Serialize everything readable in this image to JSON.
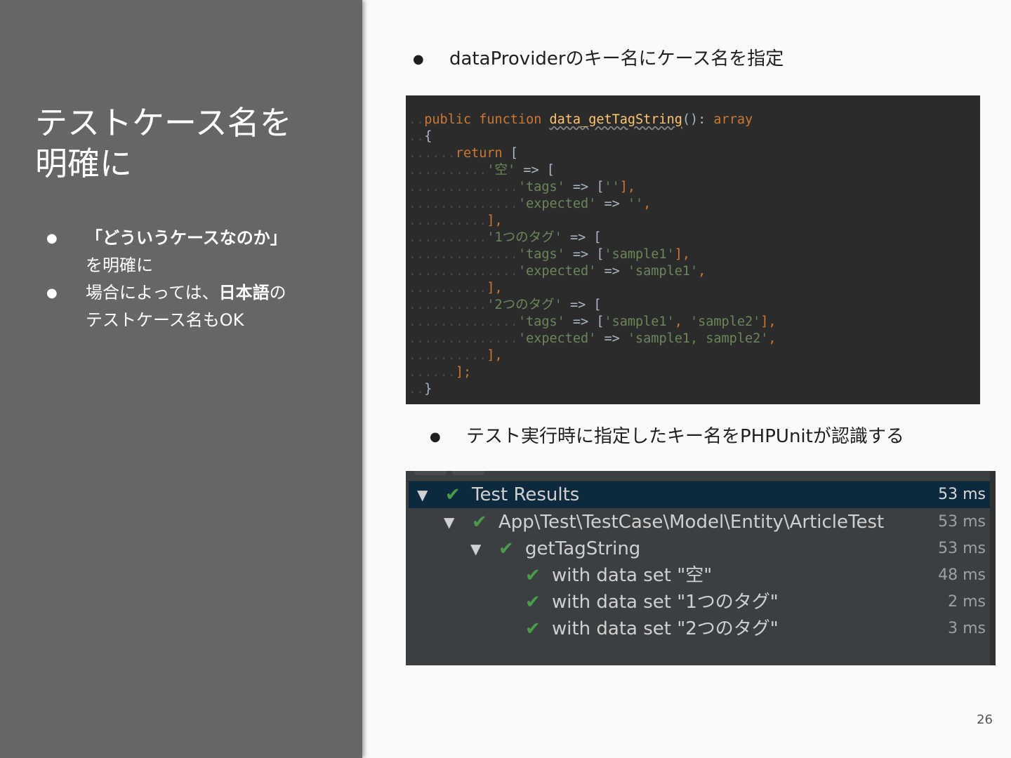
{
  "sidebar": {
    "title_line1": "テストケース名を",
    "title_line2": "明確に",
    "bullet1_part1": "「どういうケースなのか」",
    "bullet1_part2": "を明確に",
    "bullet2_part1": "場合によっては、",
    "bullet2_bold": "日本語",
    "bullet2_part2": "の",
    "bullet2_part3": "テストケース名もOK"
  },
  "main": {
    "bullet_dot": "●",
    "bullet_top": "dataProviderのキー名にケース名を指定",
    "bullet_mid": "テスト実行時に指定したキー名をPHPUnitが認識する"
  },
  "code": {
    "l1_kw": "public function",
    "l1_fn": "data_getTagString",
    "l1_rest": "():",
    "l1_type": "array",
    "l2": "{",
    "l3_kw": "return",
    "l3_rest": "[",
    "l4_key": "'空'",
    "l4_rest": "=> [",
    "l5_key": "'tags'",
    "l5_arrow": "=> [",
    "l5_val": "''",
    "l5_end": "],",
    "l6_key": "'expected'",
    "l6_arrow": "=>",
    "l6_val": "''",
    "l6_end": ",",
    "l7": "],",
    "l8_key": "'1つのタグ'",
    "l8_rest": "=> [",
    "l9_key": "'tags'",
    "l9_arrow": "=> [",
    "l9_val": "'sample1'",
    "l9_end": "],",
    "l10_key": "'expected'",
    "l10_arrow": "=>",
    "l10_val": "'sample1'",
    "l10_end": ",",
    "l11": "],",
    "l12_key": "'2つのタグ'",
    "l12_rest": "=> [",
    "l13_key": "'tags'",
    "l13_arrow": "=> [",
    "l13_val1": "'sample1'",
    "l13_comma": ",",
    "l13_val2": "'sample2'",
    "l13_end": "],",
    "l14_key": "'expected'",
    "l14_arrow": "=>",
    "l14_val": "'sample1, sample2'",
    "l14_end": ",",
    "l15": "],",
    "l16": "];",
    "l17": "}"
  },
  "results": {
    "rows": [
      {
        "label": "Test Results",
        "time": "53 ms"
      },
      {
        "label": "App\\Test\\TestCase\\Model\\Entity\\ArticleTest",
        "time": "53 ms"
      },
      {
        "label": "getTagString",
        "time": "53 ms"
      },
      {
        "label": "with data set \"空\"",
        "time": "48 ms"
      },
      {
        "label": "with data set \"1つのタグ\"",
        "time": "2 ms"
      },
      {
        "label": "with data set \"2つのタグ\"",
        "time": "3 ms"
      }
    ]
  },
  "page_number": "26"
}
